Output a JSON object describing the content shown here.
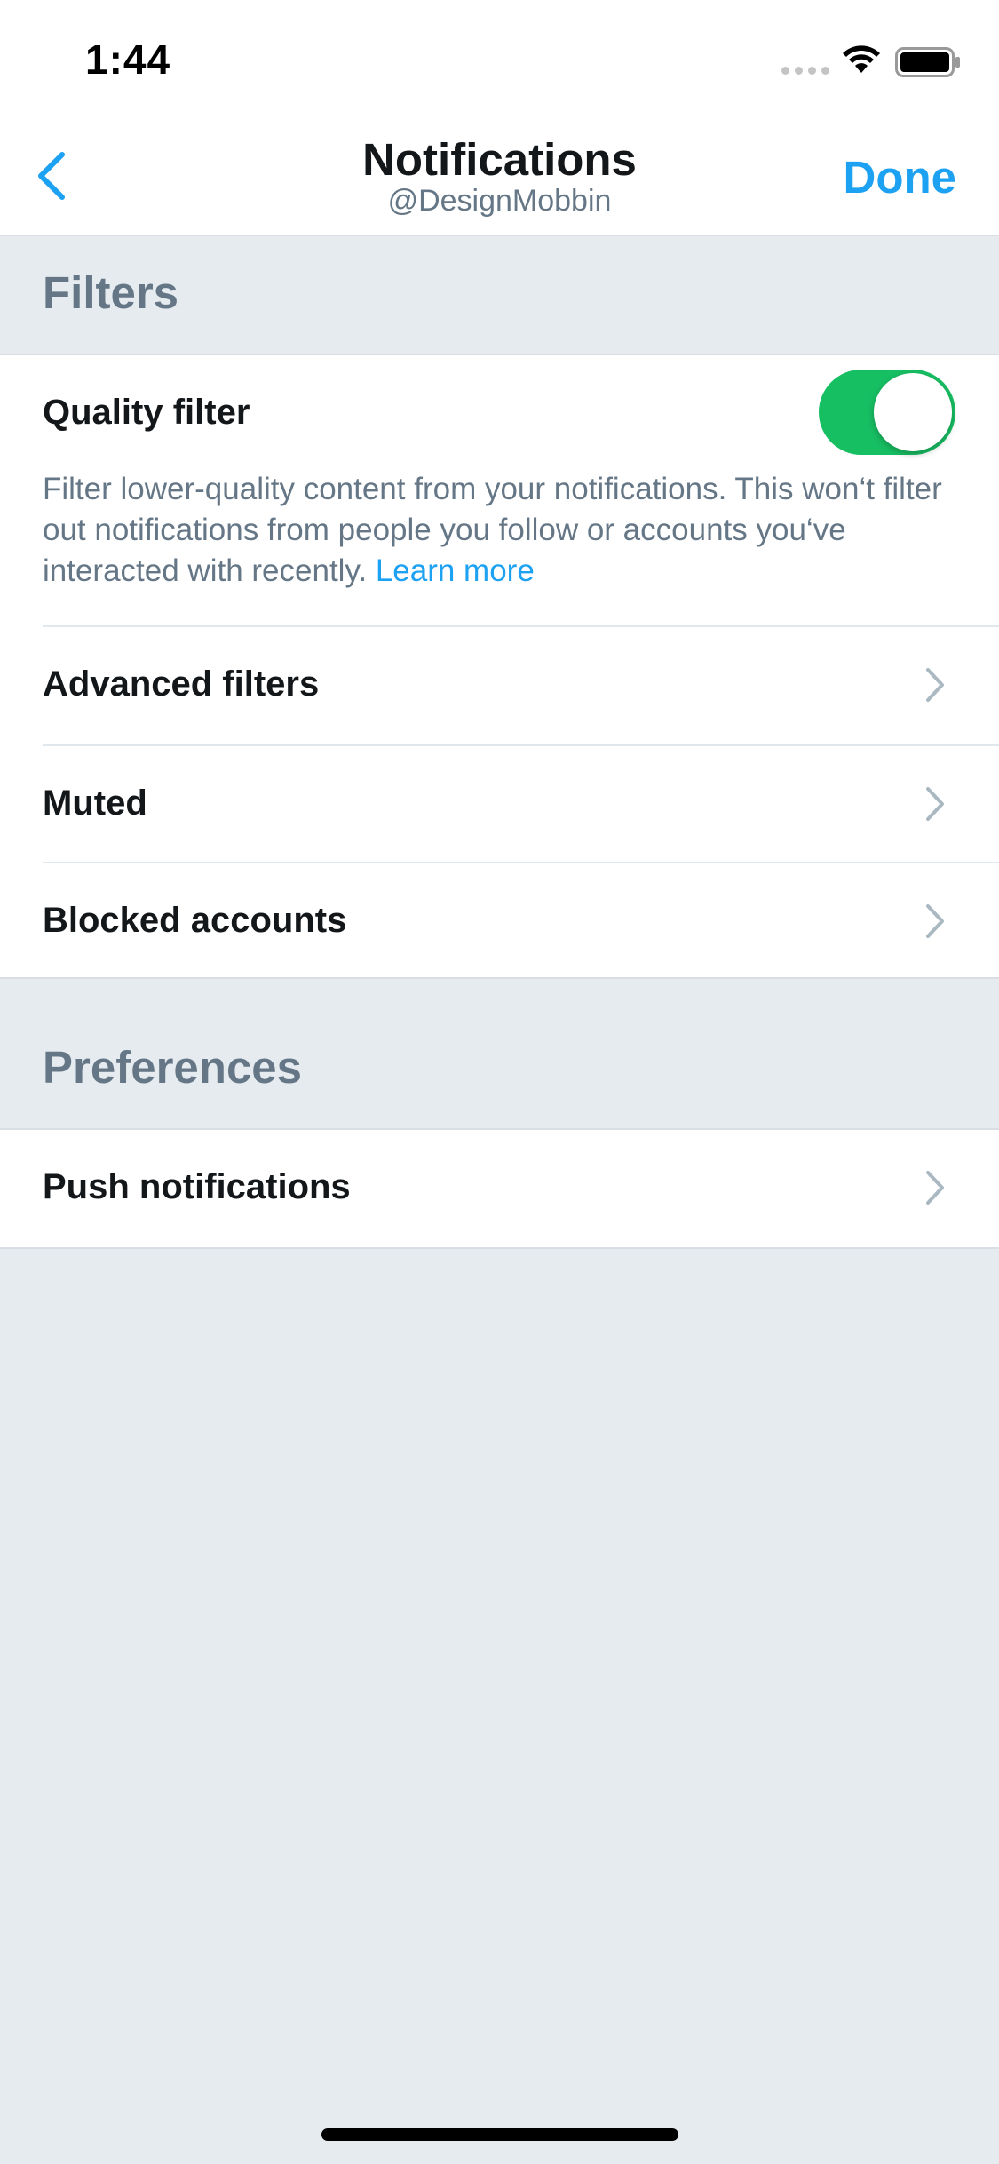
{
  "status_bar": {
    "time": "1:44",
    "signal_icon": "signal-dots-icon",
    "wifi_icon": "wifi-icon",
    "battery_icon": "battery-icon"
  },
  "nav": {
    "back_icon": "chevron-left-icon",
    "title": "Notifications",
    "subtitle": "@DesignMobbin",
    "done_label": "Done"
  },
  "sections": {
    "filters": {
      "label": "Filters",
      "quality_filter": {
        "label": "Quality filter",
        "enabled": true,
        "description": "Filter lower-quality content from your notifications. This won‘t filter out notifications from people you follow or accounts you‘ve interacted with recently.",
        "link_text": "Learn more"
      },
      "items": [
        {
          "label": "Advanced filters"
        },
        {
          "label": "Muted"
        },
        {
          "label": "Blocked accounts"
        }
      ]
    },
    "preferences": {
      "label": "Preferences",
      "items": [
        {
          "label": "Push notifications"
        }
      ]
    }
  },
  "colors": {
    "accent": "#1da1f2",
    "toggle_on": "#17bf63",
    "secondary_text": "#657786",
    "background": "#e6ebf0"
  }
}
